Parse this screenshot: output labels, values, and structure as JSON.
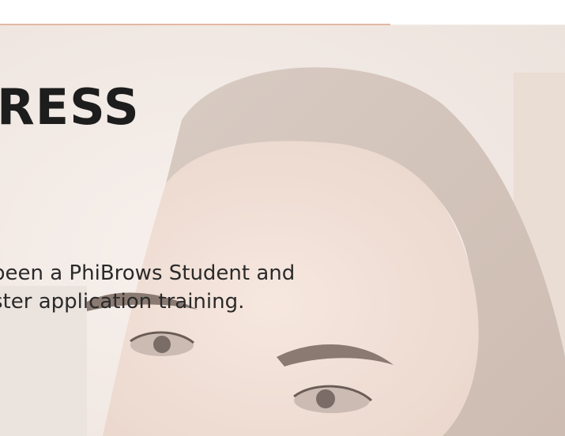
{
  "hero": {
    "headline": "RESS",
    "body_lines": [
      "been a PhiBrows Student and",
      "ster application training."
    ]
  },
  "colors": {
    "background": "#f3ebe6",
    "accent": "#e2b8a2",
    "headline": "#1d1d1d",
    "body_text": "#2a2a2a"
  }
}
